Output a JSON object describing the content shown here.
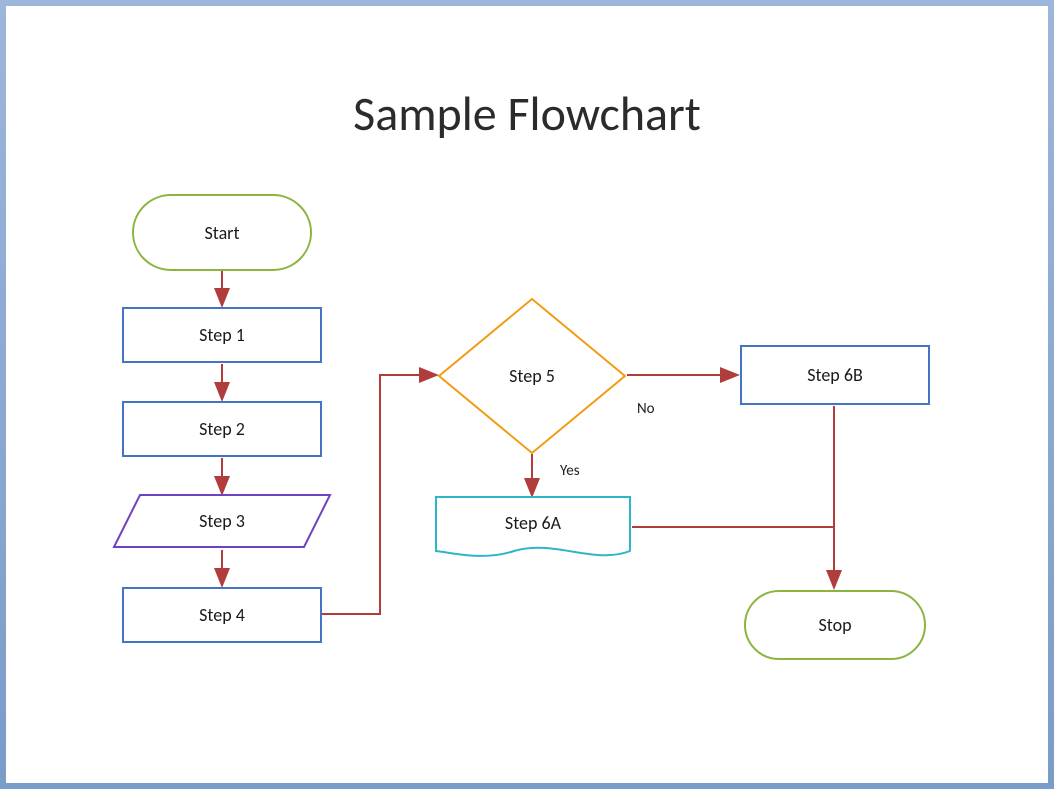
{
  "title": "Sample Flowchart",
  "nodes": {
    "start": {
      "label": "Start"
    },
    "step1": {
      "label": "Step 1"
    },
    "step2": {
      "label": "Step 2"
    },
    "step3": {
      "label": "Step 3"
    },
    "step4": {
      "label": "Step 4"
    },
    "step5": {
      "label": "Step 5"
    },
    "step6a": {
      "label": "Step 6A"
    },
    "step6b": {
      "label": "Step 6B"
    },
    "stop": {
      "label": "Stop"
    }
  },
  "edges": {
    "yes": "Yes",
    "no": "No"
  },
  "colors": {
    "terminator_stroke": "#8bb53f",
    "process_stroke": "#4472c4",
    "data_stroke": "#6f42c1",
    "decision_stroke": "#f39c12",
    "document_stroke": "#2db5c8",
    "arrow": "#b03c3c"
  }
}
